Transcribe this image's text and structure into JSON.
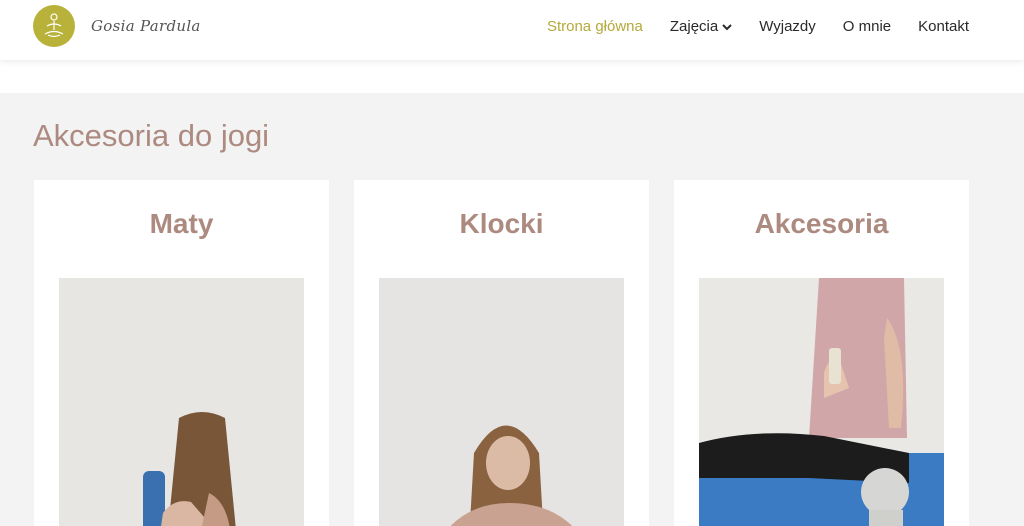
{
  "brand": {
    "script_name": "Gosia Pardula"
  },
  "nav": {
    "items": [
      {
        "label": "Strona główna",
        "active": true
      },
      {
        "label": "Zajęcia",
        "has_dropdown": true
      },
      {
        "label": "Wyjazdy"
      },
      {
        "label": "O mnie"
      },
      {
        "label": "Kontakt"
      }
    ]
  },
  "section": {
    "title": "Akcesoria do jogi"
  },
  "cards": [
    {
      "title": "Maty"
    },
    {
      "title": "Klocki"
    },
    {
      "title": "Akcesoria"
    }
  ],
  "colors": {
    "accent": "#b5a93a",
    "logo": "#b8b23b",
    "heading": "#ad8a80"
  }
}
